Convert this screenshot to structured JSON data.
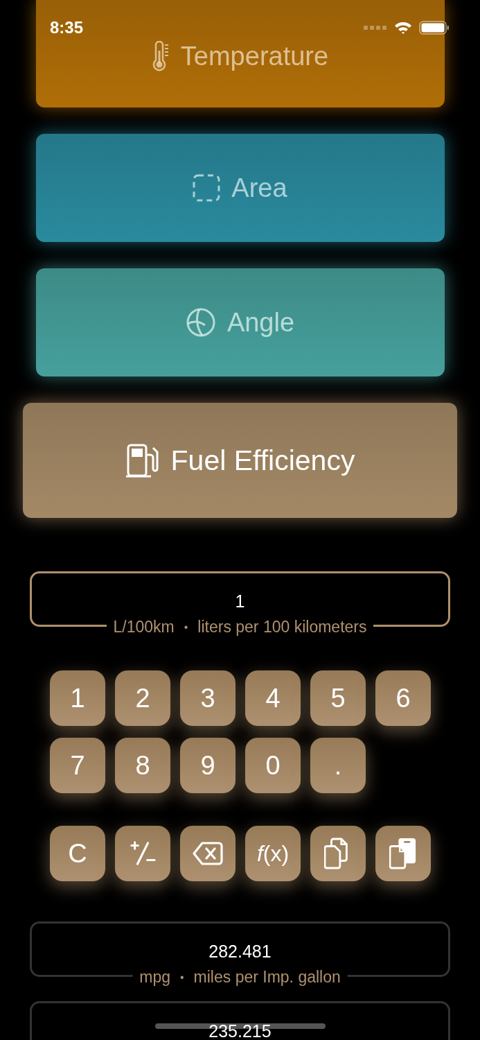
{
  "status_bar": {
    "time": "8:35"
  },
  "categories": [
    {
      "label": "Temperature",
      "kind": "thermometer",
      "color": "#b06e08",
      "selected": false
    },
    {
      "label": "Area",
      "kind": "area",
      "color": "#2a8a9e",
      "selected": false
    },
    {
      "label": "Angle",
      "kind": "angle",
      "color": "#46a09c",
      "selected": false
    },
    {
      "label": "Fuel Efficiency",
      "kind": "fuel",
      "color": "#a48966",
      "selected": true
    }
  ],
  "input": {
    "value": "1",
    "unit": "L/100km",
    "separator": "•",
    "description": "liters per 100 kilometers"
  },
  "keypad": {
    "digits": [
      "1",
      "2",
      "3",
      "4",
      "5",
      "6",
      "7",
      "8",
      "9",
      "0",
      "."
    ],
    "functions": [
      {
        "kind": "clear",
        "label": "C"
      },
      {
        "kind": "sign"
      },
      {
        "kind": "backspace"
      },
      {
        "kind": "function",
        "label": "*f*(x)"
      },
      {
        "kind": "copy"
      },
      {
        "kind": "paste"
      }
    ]
  },
  "results": [
    {
      "value": "282.481",
      "unit": "mpg",
      "separator": "•",
      "description": "miles per Imp. gallon"
    },
    {
      "value": "235.215"
    }
  ]
}
